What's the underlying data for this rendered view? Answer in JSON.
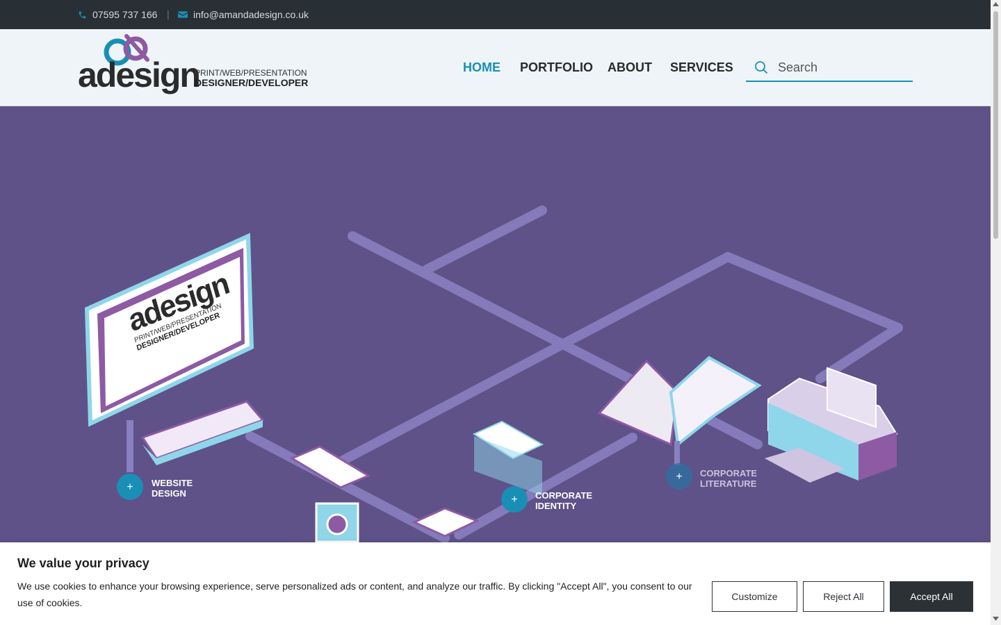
{
  "topbar": {
    "phone": "07595 737 166",
    "separator": "|",
    "email": "info@amandadesign.co.uk",
    "icons": {
      "phone": "phone-icon",
      "email": "envelope-icon"
    }
  },
  "header": {
    "logo": {
      "wordmark": "adesign",
      "tagline1": "PRINT/WEB/PRESENTATION",
      "tagline2": "DESIGNER/DEVELOPER"
    },
    "nav": [
      {
        "label": "HOME",
        "active": true
      },
      {
        "label": "PORTFOLIO",
        "active": false
      },
      {
        "label": "ABOUT",
        "active": false
      },
      {
        "label": "SERVICES",
        "active": false
      }
    ],
    "search": {
      "placeholder": "Search",
      "icon": "search-icon"
    }
  },
  "hero": {
    "services": [
      {
        "line1": "WEBSITE",
        "line2": "DESIGN"
      },
      {
        "line1": "CORPORATE",
        "line2": "IDENTITY"
      },
      {
        "line1": "CORPORATE",
        "line2": "LITERATURE"
      }
    ],
    "screen_logo": {
      "wordmark": "adesign",
      "tagline1": "PRINT/WEB/PRESENTATION",
      "tagline2": "DESIGNER/DEVELOPER"
    }
  },
  "cookie": {
    "title": "We value your privacy",
    "text": "We use cookies to enhance your browsing experience, serve personalized ads or content, and analyze our traffic. By clicking \"Accept All\", you consent to our use of cookies.",
    "buttons": {
      "customize": "Customize",
      "reject": "Reject All",
      "accept": "Accept All"
    }
  },
  "colors": {
    "accent": "#1a8fb6",
    "hero": "#5e5289",
    "topbar": "#293035",
    "purple": "#8d5aa3"
  }
}
